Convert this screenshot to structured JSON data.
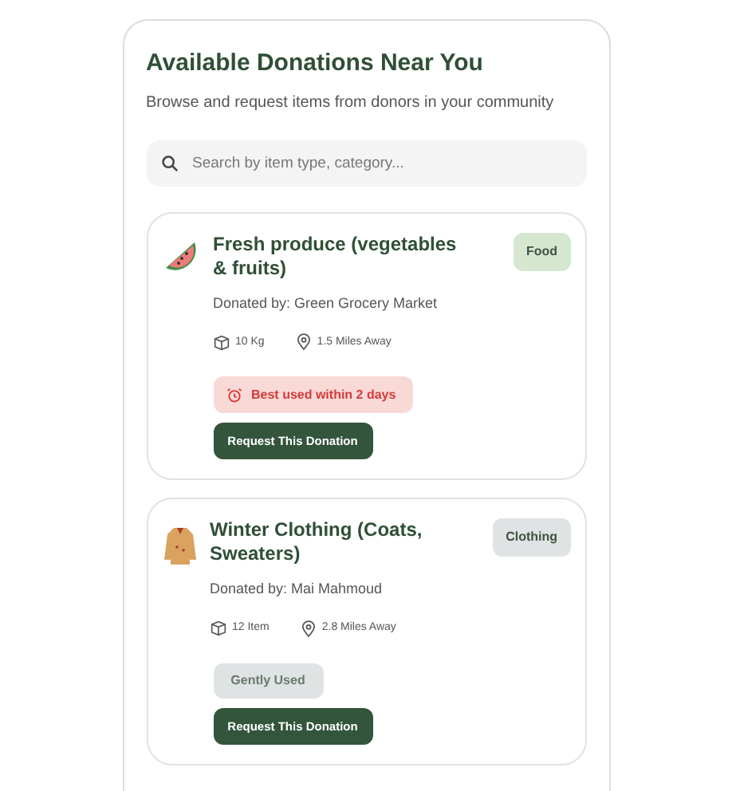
{
  "title": "Available Donations Near You",
  "subtitle": "Browse and request items from donors in your community",
  "search": {
    "placeholder": "Search by item type, category..."
  },
  "donations": [
    {
      "kind": "produce",
      "title": "Fresh produce (vegetables & fruits)",
      "category": "Food",
      "color": "#d5e8cf",
      "donor": "Donated by: Green Grocery Market",
      "quantity": "10 Kg",
      "distance": "1.5 Miles Away",
      "note": {
        "kind": "urgent",
        "text": "Best used within 2 days"
      },
      "button": "Request This Donation"
    },
    {
      "kind": "clothing",
      "title": "Winter Clothing (Coats, Sweaters)",
      "category": "Clothing",
      "color": "#dfe3e3",
      "donor": "Donated by: Mai Mahmoud",
      "quantity": "12 Item",
      "distance": "2.8 Miles Away",
      "note": {
        "kind": "condition",
        "text": "Gently Used"
      },
      "button": "Request This Donation"
    }
  ]
}
